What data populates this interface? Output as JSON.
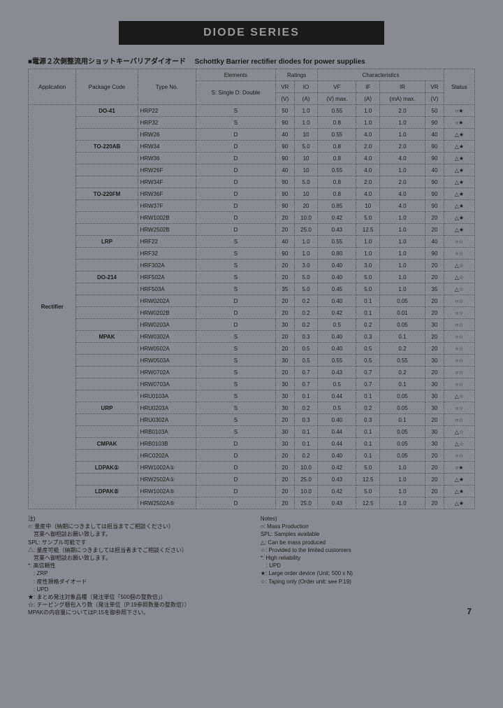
{
  "banner": "DIODE   SERIES",
  "subtitle_jp": "■電源２次側整流用ショットキーバリアダイオード",
  "subtitle_en": "Schottky Barrier rectifier diodes for power supplies",
  "headers": {
    "application": "Application",
    "package_code": "Package Code",
    "type_no": "Type No.",
    "elements": "Elements",
    "elements_sub": "S: Single D: Double",
    "ratings": "Ratings",
    "vr": "VR",
    "vr_unit": "(V)",
    "io": "IO",
    "io_unit": "(A)",
    "characteristics": "Characteristics",
    "vf": "VF",
    "vf_unit": "(V)",
    "vf_max": "max.",
    "if": "IF",
    "if_unit": "(A)",
    "ir": "IR",
    "ir_unit": "(mA)",
    "ir_max": "max.",
    "vr2": "VR",
    "vr2_unit": "(V)",
    "status": "Status"
  },
  "app_label": "Rectifier",
  "rows": [
    {
      "pkg": "DO-41",
      "type": "HRP22",
      "el": "S",
      "vr": "50",
      "io": "1.0",
      "vf": "0.55",
      "if": "1.0",
      "ir": "2.0",
      "vr2": "50",
      "st": "○★"
    },
    {
      "pkg": "",
      "type": "HRP32",
      "el": "S",
      "vr": "90",
      "io": "1.0",
      "vf": "0.8",
      "if": "1.0",
      "ir": "1.0",
      "vr2": "90",
      "st": "○★"
    },
    {
      "pkg": "",
      "type": "HRW26",
      "el": "D",
      "vr": "40",
      "io": "10",
      "vf": "0.55",
      "if": "4.0",
      "ir": "1.0",
      "vr2": "40",
      "st": "△★"
    },
    {
      "pkg": "TO-220AB",
      "type": "HRW34",
      "el": "D",
      "vr": "90",
      "io": "5.0",
      "vf": "0.8",
      "if": "2.0",
      "ir": "2.0",
      "vr2": "90",
      "st": "△★"
    },
    {
      "pkg": "",
      "type": "HRW36",
      "el": "D",
      "vr": "90",
      "io": "10",
      "vf": "0.8",
      "if": "4.0",
      "ir": "4.0",
      "vr2": "90",
      "st": "△★"
    },
    {
      "pkg": "",
      "type": "HRW26F",
      "el": "D",
      "vr": "40",
      "io": "10",
      "vf": "0.55",
      "if": "4.0",
      "ir": "1.0",
      "vr2": "40",
      "st": "△★"
    },
    {
      "pkg": "",
      "type": "HRW34F",
      "el": "D",
      "vr": "90",
      "io": "5.0",
      "vf": "0.8",
      "if": "2.0",
      "ir": "2.0",
      "vr2": "90",
      "st": "△★"
    },
    {
      "pkg": "TO-220FM",
      "type": "HRW36F",
      "el": "D",
      "vr": "90",
      "io": "10",
      "vf": "0.8",
      "if": "4.0",
      "ir": "4.0",
      "vr2": "90",
      "st": "△★"
    },
    {
      "pkg": "",
      "type": "HRW37F",
      "el": "D",
      "vr": "90",
      "io": "20",
      "vf": "0.85",
      "if": "10",
      "ir": "4.0",
      "vr2": "90",
      "st": "△★"
    },
    {
      "pkg": "",
      "type": "HRW1002B",
      "el": "D",
      "vr": "20",
      "io": "10.0",
      "vf": "0.42",
      "if": "5.0",
      "ir": "1.0",
      "vr2": "20",
      "st": "△★"
    },
    {
      "pkg": "",
      "type": "HRW2502B",
      "el": "D",
      "vr": "20",
      "io": "25.0",
      "vf": "0.43",
      "if": "12.5",
      "ir": "1.0",
      "vr2": "20",
      "st": "△★"
    },
    {
      "pkg": "LRP",
      "type": "HRF22",
      "el": "S",
      "vr": "40",
      "io": "1.0",
      "vf": "0.55",
      "if": "1.0",
      "ir": "1.0",
      "vr2": "40",
      "st": "○☆"
    },
    {
      "pkg": "",
      "type": "HRF32",
      "el": "S",
      "vr": "90",
      "io": "1.0",
      "vf": "0.80",
      "if": "1.0",
      "ir": "1.0",
      "vr2": "90",
      "st": "○☆"
    },
    {
      "pkg": "",
      "type": "HRF302A",
      "el": "S",
      "vr": "20",
      "io": "3.0",
      "vf": "0.40",
      "if": "3.0",
      "ir": "1.0",
      "vr2": "20",
      "st": "△☆"
    },
    {
      "pkg": "DO-214",
      "type": "HRF502A",
      "el": "S",
      "vr": "20",
      "io": "5.0",
      "vf": "0.40",
      "if": "5.0",
      "ir": "1.0",
      "vr2": "20",
      "st": "△☆"
    },
    {
      "pkg": "",
      "type": "HRF503A",
      "el": "S",
      "vr": "35",
      "io": "5.0",
      "vf": "0.45",
      "if": "5.0",
      "ir": "1.0",
      "vr2": "35",
      "st": "△☆"
    },
    {
      "pkg": "",
      "type": "HRW0202A",
      "el": "D",
      "vr": "20",
      "io": "0.2",
      "vf": "0.40",
      "if": "0.1",
      "ir": "0.05",
      "vr2": "20",
      "st": "○☆"
    },
    {
      "pkg": "",
      "type": "HRW0202B",
      "el": "D",
      "vr": "20",
      "io": "0.2",
      "vf": "0.42",
      "if": "0.1",
      "ir": "0.01",
      "vr2": "20",
      "st": "○☆"
    },
    {
      "pkg": "",
      "type": "HRW0203A",
      "el": "D",
      "vr": "30",
      "io": "0.2",
      "vf": "0.5",
      "if": "0.2",
      "ir": "0.05",
      "vr2": "30",
      "st": "○☆"
    },
    {
      "pkg": "MPAK",
      "type": "HRW0302A",
      "el": "S",
      "vr": "20",
      "io": "0.3",
      "vf": "0.40",
      "if": "0.3",
      "ir": "0.1",
      "vr2": "20",
      "st": "○☆"
    },
    {
      "pkg": "",
      "type": "HRW0502A",
      "el": "S",
      "vr": "20",
      "io": "0.5",
      "vf": "0.40",
      "if": "0.5",
      "ir": "0.2",
      "vr2": "20",
      "st": "○☆"
    },
    {
      "pkg": "",
      "type": "HRW0503A",
      "el": "S",
      "vr": "30",
      "io": "0.5",
      "vf": "0.55",
      "if": "0.5",
      "ir": "0.55",
      "vr2": "30",
      "st": "○☆"
    },
    {
      "pkg": "",
      "type": "HRW0702A",
      "el": "S",
      "vr": "20",
      "io": "0.7",
      "vf": "0.43",
      "if": "0.7",
      "ir": "0.2",
      "vr2": "20",
      "st": "○☆"
    },
    {
      "pkg": "",
      "type": "HRW0703A",
      "el": "S",
      "vr": "30",
      "io": "0.7",
      "vf": "0.5",
      "if": "0.7",
      "ir": "0.1",
      "vr2": "30",
      "st": "○☆"
    },
    {
      "pkg": "",
      "type": "HRU0103A",
      "el": "S",
      "vr": "30",
      "io": "0.1",
      "vf": "0.44",
      "if": "0.1",
      "ir": "0.05",
      "vr2": "30",
      "st": "△☆"
    },
    {
      "pkg": "URP",
      "type": "HRU0203A",
      "el": "S",
      "vr": "30",
      "io": "0.2",
      "vf": "0.5",
      "if": "0.2",
      "ir": "0.05",
      "vr2": "30",
      "st": "○☆"
    },
    {
      "pkg": "",
      "type": "HRU0302A",
      "el": "S",
      "vr": "20",
      "io": "0.3",
      "vf": "0.40",
      "if": "0.3",
      "ir": "0.1",
      "vr2": "20",
      "st": "○☆"
    },
    {
      "pkg": "",
      "type": "HRB0103A",
      "el": "S",
      "vr": "30",
      "io": "0.1",
      "vf": "0.44",
      "if": "0.1",
      "ir": "0.05",
      "vr2": "30",
      "st": "△☆"
    },
    {
      "pkg": "CMPAK",
      "type": "HRB0103B",
      "el": "D",
      "vr": "30",
      "io": "0.1",
      "vf": "0.44",
      "if": "0.1",
      "ir": "0.05",
      "vr2": "30",
      "st": "△☆"
    },
    {
      "pkg": "",
      "type": "HRC0202A",
      "el": "D",
      "vr": "20",
      "io": "0.2",
      "vf": "0.40",
      "if": "0.1",
      "ir": "0.05",
      "vr2": "20",
      "st": "○☆"
    },
    {
      "pkg": "LDPAK①",
      "type": "HRW1002A①",
      "el": "D",
      "vr": "20",
      "io": "10.0",
      "vf": "0.42",
      "if": "5.0",
      "ir": "1.0",
      "vr2": "20",
      "st": "○★"
    },
    {
      "pkg": "",
      "type": "HRW2502A①",
      "el": "D",
      "vr": "20",
      "io": "25.0",
      "vf": "0.43",
      "if": "12.5",
      "ir": "1.0",
      "vr2": "20",
      "st": "△★"
    },
    {
      "pkg": "LDPAK⑤",
      "type": "HRW1002A⑤",
      "el": "D",
      "vr": "20",
      "io": "10.0",
      "vf": "0.42",
      "if": "5.0",
      "ir": "1.0",
      "vr2": "20",
      "st": "△★"
    },
    {
      "pkg": "",
      "type": "HRW2502A⑤",
      "el": "D",
      "vr": "20",
      "io": "25.0",
      "vf": "0.43",
      "if": "12.5",
      "ir": "1.0",
      "vr2": "20",
      "st": "△★"
    }
  ],
  "notes_left": [
    "注)",
    "○: 量産中（納期につきましては担当までご相談ください）",
    "　営業へ御相談お願い致します。",
    "SPL: サンプル可能です",
    "△: 量産可能（納期につきましては担当者までご相談ください）",
    "　営業へ御相談お願い致します。",
    "*: 高信頼性",
    "　: ZRP",
    "　: 産性規格ダイオード",
    "　: UPD",
    "★: まとめ発注対象品種（発注単位「500個の整数倍」）",
    "☆: テーピング梱包入り数（発注単位（P.19参照数量の整数倍））",
    "MPAKの内容量についてはP.15を御参照下さい。"
  ],
  "notes_right": [
    "Notes)",
    "○: Mass Production",
    "SPL: Samples available",
    "△: Can be mass produced",
    "☆: Provided to the limited customers",
    "*: High reliability",
    "　: UPD",
    "★: Large order device (Unit: 500 x N)",
    "☆: Taping only (Order unit: see P.19)"
  ],
  "page_num": "7"
}
